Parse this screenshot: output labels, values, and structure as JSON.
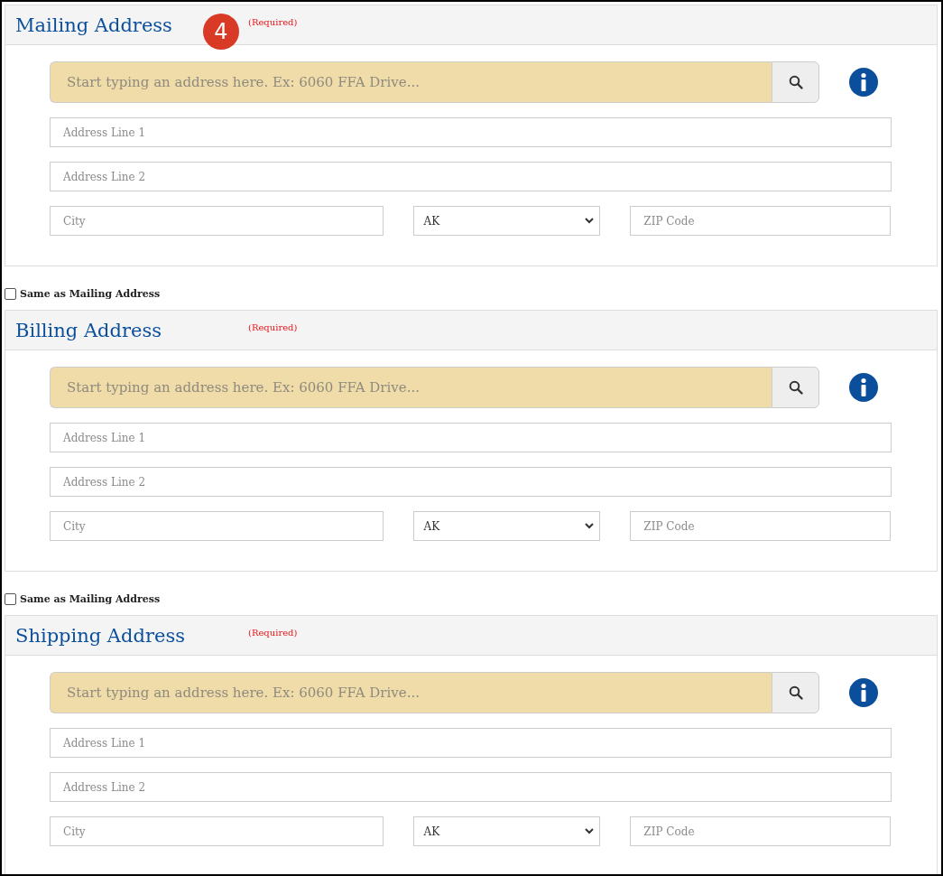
{
  "sections": [
    {
      "title": "Mailing Address",
      "required_note": "(Required)",
      "step_badge": "4",
      "search": {
        "placeholder": "Start typing an address here. Ex: 6060 FFA Drive..."
      },
      "address_line_1": {
        "placeholder": "Address Line 1"
      },
      "address_line_2": {
        "placeholder": "Address Line 2"
      },
      "city": {
        "placeholder": "City"
      },
      "state": {
        "value": "AK"
      },
      "zip": {
        "placeholder": "ZIP Code"
      }
    },
    {
      "same_as": {
        "label": "Same as Mailing Address",
        "checked": false
      },
      "title": "Billing Address",
      "required_note": "(Required)",
      "search": {
        "placeholder": "Start typing an address here. Ex: 6060 FFA Drive..."
      },
      "address_line_1": {
        "placeholder": "Address Line 1"
      },
      "address_line_2": {
        "placeholder": "Address Line 2"
      },
      "city": {
        "placeholder": "City"
      },
      "state": {
        "value": "AK"
      },
      "zip": {
        "placeholder": "ZIP Code"
      }
    },
    {
      "same_as": {
        "label": "Same as Mailing Address",
        "checked": false
      },
      "title": "Shipping Address",
      "required_note": "(Required)",
      "search": {
        "placeholder": "Start typing an address here. Ex: 6060 FFA Drive..."
      },
      "address_line_1": {
        "placeholder": "Address Line 1"
      },
      "address_line_2": {
        "placeholder": "Address Line 2"
      },
      "city": {
        "placeholder": "City"
      },
      "state": {
        "value": "AK"
      },
      "zip": {
        "placeholder": "ZIP Code"
      }
    }
  ]
}
